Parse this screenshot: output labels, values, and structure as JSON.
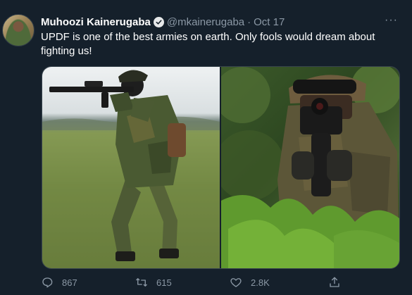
{
  "tweet": {
    "display_name": "Muhoozi Kainerugaba",
    "handle": "@mkainerugaba",
    "separator": "·",
    "time": "Oct 17",
    "text": "UPDF is one of the best armies on earth. Only fools would dream about fighting us!",
    "more": "···"
  },
  "icons": {
    "avatar": "avatar-image",
    "verified": "verified-badge-icon",
    "reply": "reply-icon",
    "retweet": "retweet-icon",
    "like": "like-icon",
    "share": "share-icon"
  },
  "media": {
    "count": 2
  },
  "actions": {
    "reply_count": "867",
    "retweet_count": "615",
    "like_count": "2.8K"
  },
  "colors": {
    "background": "#15202b",
    "text_primary": "#ffffff",
    "text_secondary": "#8b98a5",
    "border": "#38444d"
  }
}
